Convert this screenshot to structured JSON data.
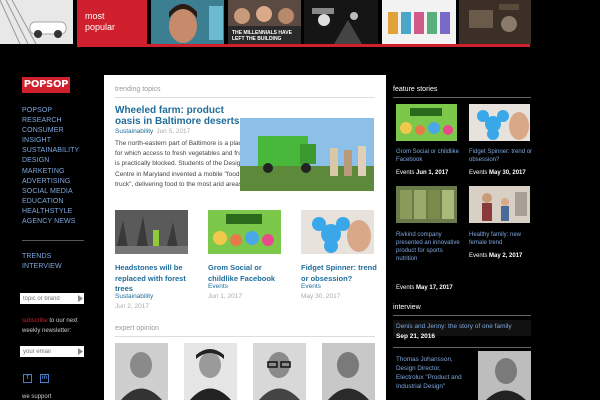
{
  "top_strip": {
    "popular_label_line1": "most",
    "popular_label_line2": "popular",
    "caption_millennials": "THE MILLENNIALS HAVE LEFT THE BUILDING"
  },
  "brand": {
    "logo": "POPSOP"
  },
  "nav_primary": [
    "POPSOP",
    "RESEARCH",
    "CONSUMER",
    "INSIGHT",
    "SUSTAINABILITY",
    "DESIGN",
    "MARKETING",
    "ADVERTISING",
    "SOCIAL MEDIA",
    "EDUCATION",
    "HEALTHSTYLE",
    "AGENCY NEWS"
  ],
  "nav_secondary": [
    "TRENDS",
    "INTERVIEW"
  ],
  "search": {
    "placeholder": "topic or brand"
  },
  "subscribe": {
    "highlight": "subscribe",
    "rest": " to our next weekly newsletter:",
    "placeholder": "your email"
  },
  "social": {
    "facebook_label": "f",
    "linkedin_label": "in"
  },
  "we_support": "we support",
  "main": {
    "trending_heading": "trending topics",
    "featured": {
      "title": "Wheeled farm: product oasis in Baltimore deserts",
      "category": "Sustainability",
      "date": "Jun 5, 2017",
      "excerpt": "The north-eastern part of Baltimore is a place for which access to fresh vegetables and fruits is practically blocked. Students of the Design Centre in Maryland invented a mobile \"food truck\", delivering food to the most arid areas."
    },
    "cards": [
      {
        "title": "Headstones will be replaced with forest trees",
        "category": "Sustainability",
        "date": "Jun 2, 2017"
      },
      {
        "title": "Grom Social or childlike Facebook",
        "category": "Events",
        "date": "Jun 1, 2017"
      },
      {
        "title": "Fidget Spinner: trend or obsession?",
        "category": "Events",
        "date": "May 30, 2017"
      }
    ],
    "expert_heading": "expert opinion"
  },
  "right": {
    "feature_heading": "feature stories",
    "stories": [
      {
        "title": "Grom Social or childlike Facebook",
        "category": "Events",
        "date": "Jun 1, 2017"
      },
      {
        "title": "Fidget Spinner: trend or obsession?",
        "category": "Events",
        "date": "May 30, 2017"
      },
      {
        "title": "Rivkind company presented an innovative product for sports nutrition",
        "category": "Events",
        "date": "May 17, 2017"
      },
      {
        "title": "Healthy family: new female trend",
        "category": "Events",
        "date": "May 2, 2017"
      }
    ],
    "interview_heading": "interview",
    "interview_title": "Denis and Jenny: the story of one family",
    "interview_date": "Sep 21, 2016",
    "interview2_title": "Thomas Johansson, Design Director, Electrolux \"Product and Industrial Design\""
  },
  "colors": {
    "brand_red": "#d0202e",
    "link_blue": "#1f6d9a",
    "nav_blue": "#7ea7de"
  }
}
